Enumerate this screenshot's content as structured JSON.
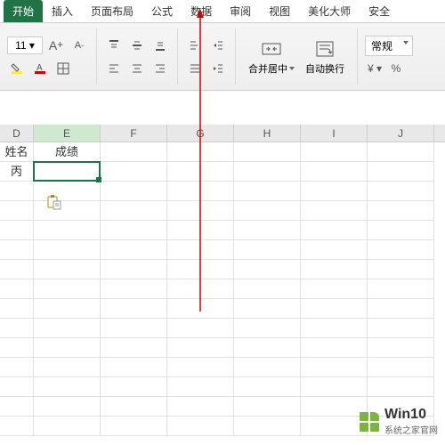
{
  "tabs": {
    "start": "开始",
    "insert": "插入",
    "pagelayout": "页面布局",
    "formula": "公式",
    "data": "数据",
    "review": "审阅",
    "view": "视图",
    "beautify": "美化大师",
    "security": "安全"
  },
  "toolbar": {
    "font_increase": "A",
    "font_decrease": "A",
    "merge_center": "合并居中",
    "auto_wrap": "自动换行",
    "number_format": "常规"
  },
  "columns": {
    "d": "D",
    "e": "E",
    "f": "F",
    "g": "G",
    "h": "H",
    "i": "I",
    "j": "J"
  },
  "cells": {
    "d1": "姓名",
    "e1": "成绩",
    "d2": "丙"
  },
  "watermark": {
    "main": "Win10",
    "sub": "系统之家官网"
  }
}
